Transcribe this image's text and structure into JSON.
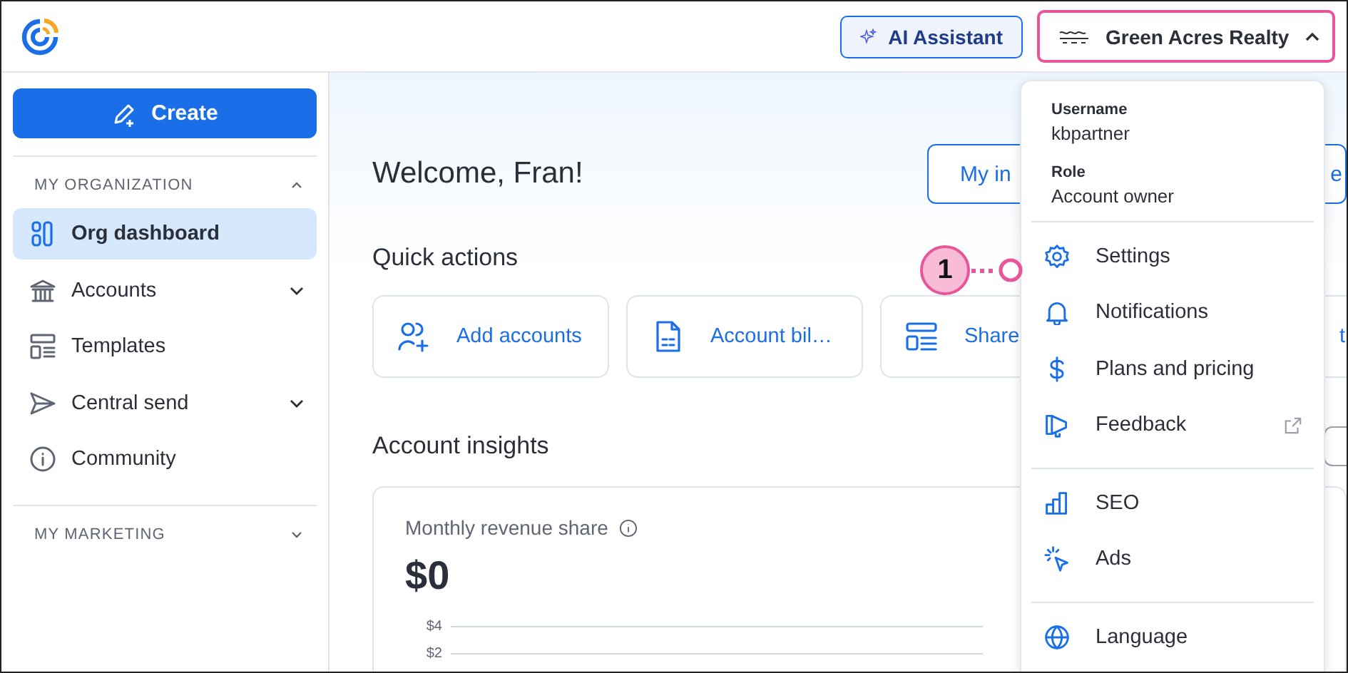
{
  "topbar": {
    "ai_button": "AI Assistant",
    "account": {
      "name": "Green Acres Realty",
      "expanded": true
    }
  },
  "sidebar": {
    "create_button": "Create",
    "sections": [
      {
        "title": "MY ORGANIZATION",
        "expanded": true,
        "items": [
          {
            "label": "Org dashboard",
            "selected": true,
            "has_submenu": false
          },
          {
            "label": "Accounts",
            "selected": false,
            "has_submenu": true
          },
          {
            "label": "Templates",
            "selected": false,
            "has_submenu": false
          },
          {
            "label": "Central send",
            "selected": false,
            "has_submenu": true
          },
          {
            "label": "Community",
            "selected": false,
            "has_submenu": false
          }
        ]
      },
      {
        "title": "MY MARKETING",
        "expanded": false
      }
    ]
  },
  "main": {
    "title": "Welcome, Fran!",
    "header_buttons": [
      "My in",
      "e"
    ],
    "quick_actions": {
      "title": "Quick actions",
      "cards": [
        "Add accounts",
        "Account bil…",
        "Share",
        "t"
      ]
    },
    "insights": {
      "title": "Account insights",
      "card": {
        "title": "Monthly revenue share",
        "value": "$0",
        "y_ticks": [
          "$4",
          "$2"
        ]
      }
    }
  },
  "menu": {
    "username_label": "Username",
    "username": "kbpartner",
    "role_label": "Role",
    "role": "Account owner",
    "groups": [
      [
        {
          "label": "Settings",
          "external": false
        },
        {
          "label": "Notifications",
          "external": false
        },
        {
          "label": "Plans and pricing",
          "external": false
        },
        {
          "label": "Feedback",
          "external": true
        }
      ],
      [
        {
          "label": "SEO",
          "external": false
        },
        {
          "label": "Ads",
          "external": false
        }
      ],
      [
        {
          "label": "Language",
          "external": false
        }
      ]
    ]
  },
  "annotation": {
    "number": "1"
  }
}
